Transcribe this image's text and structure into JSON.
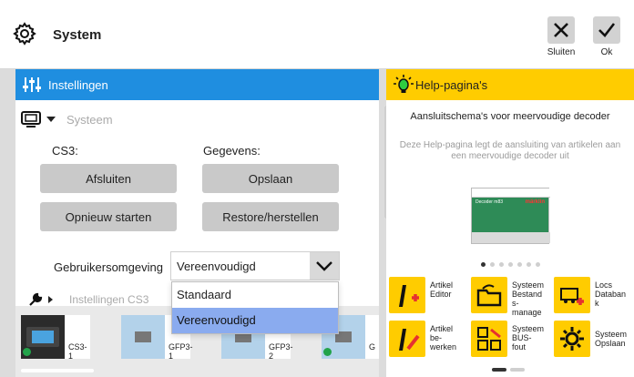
{
  "window": {
    "title": "System"
  },
  "toolbar": {
    "close_label": "Sluiten",
    "ok_label": "Ok"
  },
  "settings": {
    "header": "Instellingen",
    "system_dropdown": "Systeem",
    "cs3_label": "CS3:",
    "data_label": "Gegevens:",
    "shutdown_button": "Afsluiten",
    "save_button": "Opslaan",
    "restart_button": "Opnieuw starten",
    "restore_button": "Restore/herstellen",
    "environment_label": "Gebruikersomgeving",
    "environment_value": "Vereenvoudigd",
    "options": [
      "Standaard",
      "Vereenvoudigd"
    ],
    "submenu_label": "Instellingen CS3"
  },
  "articles": [
    {
      "name": "CS3-1",
      "checked": true
    },
    {
      "name": "GFP3-1",
      "checked": false
    },
    {
      "name": "GFP3-2",
      "checked": false
    },
    {
      "name": "G",
      "checked": true
    }
  ],
  "help": {
    "header": "Help-pagina's",
    "title": "Aansluitschema's voor meervoudige decoder",
    "description": "Deze Help-pagina legt de aansluiting van artikelen aan een meervoudige decoder uit",
    "device_tag": "Decoder m83",
    "device_brand": "märklin",
    "slides": {
      "count": 7,
      "active": 0
    },
    "tiles": [
      {
        "label": "Artikel\nEditor",
        "icon": "artikel-editor-icon"
      },
      {
        "label": "Systeem\nBestand\ns-\nmanage",
        "icon": "file-manager-icon"
      },
      {
        "label": "Locs\nDataban\nk",
        "icon": "locs-database-icon"
      },
      {
        "label": "Artikel\nbe-\nwerken",
        "icon": "edit-article-icon"
      },
      {
        "label": "Systeem\nBUS-\nfout",
        "icon": "bus-error-icon"
      },
      {
        "label": "Systeem\nOpslaan",
        "icon": "system-save-icon"
      }
    ]
  },
  "colors": {
    "settings_header": "#1f8ee0",
    "help_header": "#ffcc00",
    "selected_option": "#8aabef",
    "accent_red": "#e63030"
  }
}
